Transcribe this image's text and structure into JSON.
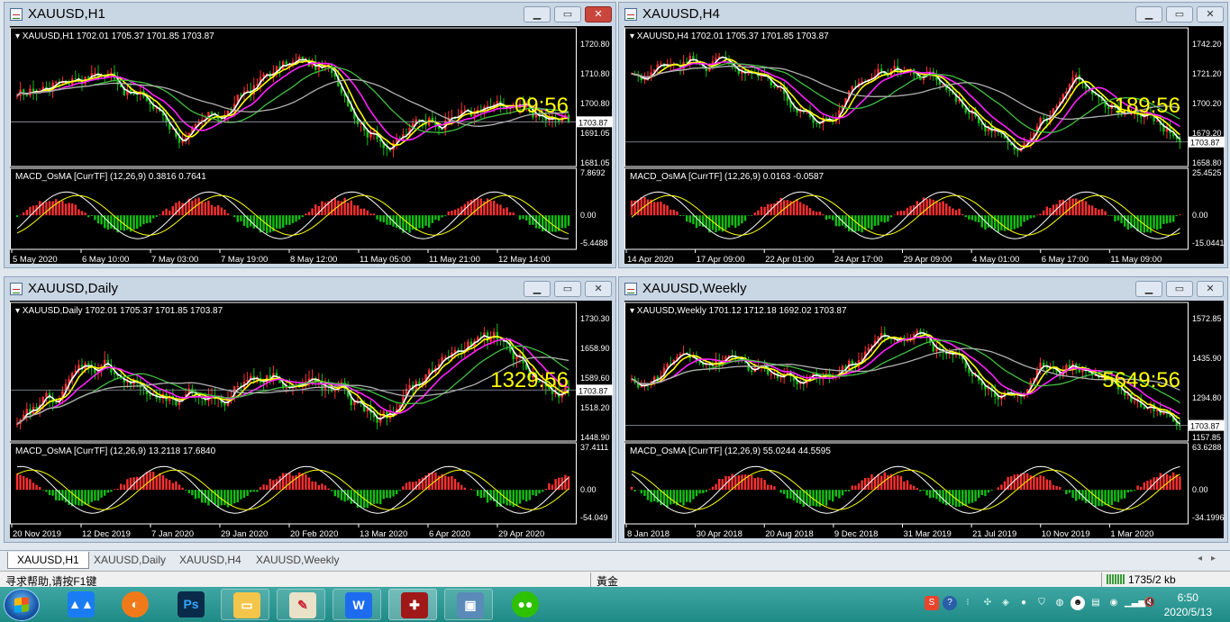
{
  "colors": {
    "bull": "#ff3030",
    "bear": "#10c010",
    "ma_fast": "#ffffff",
    "ma_mid": "#ffff00",
    "ma_slow": "#ff20ff",
    "ma_long": "#40c040",
    "ma_longest": "#b0b0b0",
    "countdown": "#ffff00"
  },
  "windows": [
    {
      "title": "XAUUSD,H1",
      "info": "XAUUSD,H1  1702.01 1705.37 1701.85 1703.87",
      "countdown": "09:56",
      "price_scale": [
        "1720.80",
        "1710.80",
        "1700.80",
        "1691.05",
        "1681.05"
      ],
      "current_price": "1703.87",
      "macd_label": "MACD_OsMA [CurrTF] (12,26,9) 0.3816 0.7641",
      "macd_scale": [
        "7.8692",
        "0.00",
        "-5.4488"
      ],
      "time_axis": [
        "5 May 2020",
        "6 May 10:00",
        "7 May 03:00",
        "7 May 19:00",
        "8 May 12:00",
        "11 May 05:00",
        "11 May 21:00",
        "12 May 14:00"
      ]
    },
    {
      "title": "XAUUSD,H4",
      "info": "XAUUSD,H4  1702.01 1705.37 1701.85 1703.87",
      "countdown": "189:56",
      "price_scale": [
        "1742.20",
        "1721.20",
        "1700.20",
        "1679.20",
        "1658.80"
      ],
      "current_price": "1703.87",
      "macd_label": "MACD_OsMA [CurrTF] (12,26,9) 0.0163 -0.0587",
      "macd_scale": [
        "25.4525",
        "0.00",
        "-15.0441"
      ],
      "time_axis": [
        "14 Apr 2020",
        "17 Apr 09:00",
        "22 Apr 01:00",
        "24 Apr 17:00",
        "29 Apr 09:00",
        "4 May 01:00",
        "6 May 17:00",
        "11 May 09:00"
      ]
    },
    {
      "title": "XAUUSD,Daily",
      "info": "XAUUSD,Daily  1702.01 1705.37 1701.85 1703.87",
      "countdown": "1329:56",
      "price_scale": [
        "1730.30",
        "1658.90",
        "1589.60",
        "1518.20",
        "1448.90"
      ],
      "current_price": "1703.87",
      "macd_label": "MACD_OsMA [CurrTF] (12,26,9) 13.2118 17.6840",
      "macd_scale": [
        "37.4111",
        "0.00",
        "-54.049"
      ],
      "time_axis": [
        "20 Nov 2019",
        "12 Dec 2019",
        "7 Jan 2020",
        "29 Jan 2020",
        "20 Feb 2020",
        "13 Mar 2020",
        "6 Apr 2020",
        "29 Apr 2020"
      ]
    },
    {
      "title": "XAUUSD,Weekly",
      "info": "XAUUSD,Weekly  1701.12 1712.18 1692.02 1703.87",
      "countdown": "5649:56",
      "price_scale": [
        "1572.85",
        "1435.90",
        "1294.80",
        "1157.85"
      ],
      "current_price": "1703.87",
      "macd_label": "MACD_OsMA [CurrTF] (12,26,9) 55.0244 44.5595",
      "macd_scale": [
        "63.6288",
        "0.00",
        "-34.1996"
      ],
      "time_axis": [
        "8 Jan 2018",
        "30 Apr 2018",
        "20 Aug 2018",
        "9 Dec 2018",
        "31 Mar 2019",
        "21 Jul 2019",
        "10 Nov 2019",
        "1 Mar 2020"
      ]
    }
  ],
  "tabs": [
    "XAUUSD,H1",
    "XAUUSD,Daily",
    "XAUUSD,H4",
    "XAUUSD,Weekly"
  ],
  "active_tab": 0,
  "status": {
    "help": "寻求帮助,请按F1键",
    "profile": "黃金",
    "traffic": "1735/2 kb"
  },
  "taskbar": {
    "apps": [
      "start-orb",
      "tencent-meeting-icon",
      "browser-icon",
      "photoshop-icon",
      "folder-icon",
      "map-app-icon",
      "wps-icon",
      "metatrader-icon",
      "image-viewer-icon",
      "wechat-icon"
    ],
    "time": "6:50",
    "date": "2020/5/13"
  }
}
